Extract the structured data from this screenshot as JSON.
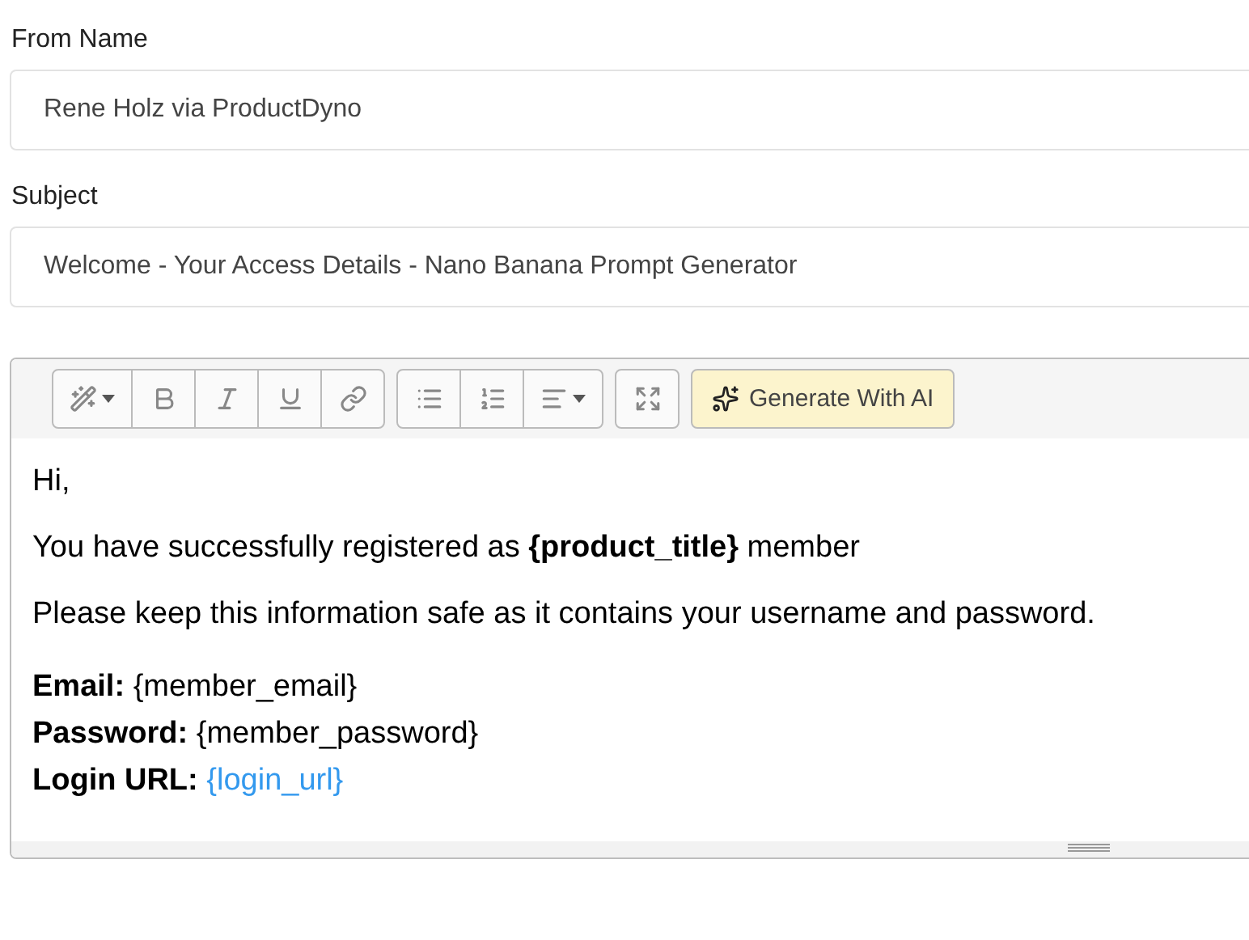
{
  "fields": [
    {
      "label": "From Name",
      "value": "Rene Holz via ProductDyno"
    },
    {
      "label": "Subject",
      "value": "Welcome - Your Access Details - Nano Banana Prompt Generator"
    }
  ],
  "editor": {
    "toolbar": [
      {
        "buttons": [
          {
            "kind": "magic",
            "caret": true
          },
          {
            "kind": "bold"
          },
          {
            "kind": "italic"
          },
          {
            "kind": "underline"
          },
          {
            "kind": "link"
          }
        ]
      },
      {
        "buttons": [
          {
            "kind": "bullets"
          },
          {
            "kind": "numbers"
          },
          {
            "kind": "align",
            "caret": true
          }
        ]
      },
      {
        "buttons": [
          {
            "kind": "expand"
          }
        ]
      }
    ],
    "ai_button": "Generate With AI",
    "paragraphs": [
      "Hi,",
      "You have successfully registered as **{product_title}** member",
      "Please keep this information safe as it contains your username and password."
    ],
    "details": [
      {
        "label": "Email:",
        "value": "{member_email}",
        "kind": "text"
      },
      {
        "label": "Password:",
        "value": "{member_password}",
        "kind": "text"
      },
      {
        "label": "Login URL:",
        "value": "{login_url}",
        "kind": "link"
      }
    ]
  }
}
